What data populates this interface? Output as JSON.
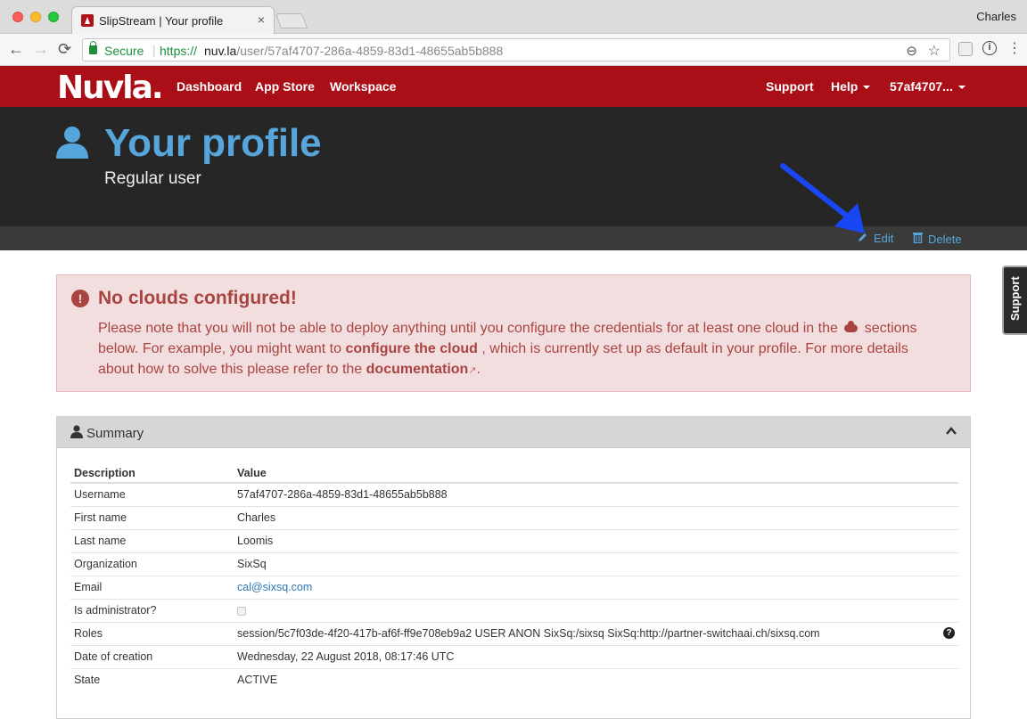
{
  "browser": {
    "tab_title": "SlipStream | Your profile",
    "tab_close": "×",
    "profile_name": "Charles",
    "secure_label": "Secure",
    "url_scheme": "https://",
    "url_host": "nuv.la",
    "url_path": "/user/57af4707-286a-4859-83d1-48655ab5b888",
    "back_glyph": "←",
    "forward_glyph": "→",
    "reload_glyph": "⟳",
    "zoom_glyph": "⊖",
    "star_glyph": "☆",
    "info_glyph": "i",
    "menu_glyph": "⋮"
  },
  "site_nav": {
    "logo": "Nuvla.",
    "links": [
      "Dashboard",
      "App Store",
      "Workspace"
    ],
    "support": "Support",
    "help": "Help",
    "user": "57af4707..."
  },
  "header": {
    "title": "Your profile",
    "subtitle": "Regular user",
    "actions": {
      "edit": "Edit",
      "delete": "Delete"
    }
  },
  "alert": {
    "icon": "!",
    "title": "No clouds configured!",
    "part1": "Please note that you will not be able to deploy anything until you configure the credentials for at least one cloud in the",
    "part2": "sections below. For example, you might want to",
    "link1": "configure the cloud",
    "part3": ", which is currently set up as default in your profile. For more details about how to solve this please refer to the",
    "link2": "documentation",
    "part4": "."
  },
  "summary": {
    "title": "Summary",
    "columns": {
      "key": "Description",
      "value": "Value"
    },
    "rows": [
      {
        "key": "Username",
        "value": "57af4707-286a-4859-83d1-48655ab5b888"
      },
      {
        "key": "First name",
        "value": "Charles"
      },
      {
        "key": "Last name",
        "value": "Loomis"
      },
      {
        "key": "Organization",
        "value": "SixSq"
      },
      {
        "key": "Email",
        "value": "cal@sixsq.com"
      },
      {
        "key": "Is administrator?",
        "value": ""
      },
      {
        "key": "Roles",
        "value": "session/5c7f03de-4f20-417b-af6f-ff9e708eb9a2 USER ANON SixSq:/sixsq SixSq:http://partner-switchaai.ch/sixsq.com",
        "help": "?"
      },
      {
        "key": "Date of creation",
        "value": "Wednesday, 22 August 2018, 08:17:46 UTC"
      },
      {
        "key": "State",
        "value": "ACTIVE"
      }
    ]
  },
  "support_tab": "Support",
  "colors": {
    "brand_red": "#aa0e17",
    "header_dark": "#262626",
    "title_blue": "#56a6dc",
    "alert_text": "#a94442",
    "alert_bg": "#f2dede",
    "annotation_arrow": "#1a47f5"
  },
  "icons": {
    "user": "user-icon",
    "edit": "pencil-icon",
    "delete": "trash-icon",
    "alert": "exclamation-circle-icon",
    "collapse": "chevron-up-icon"
  }
}
